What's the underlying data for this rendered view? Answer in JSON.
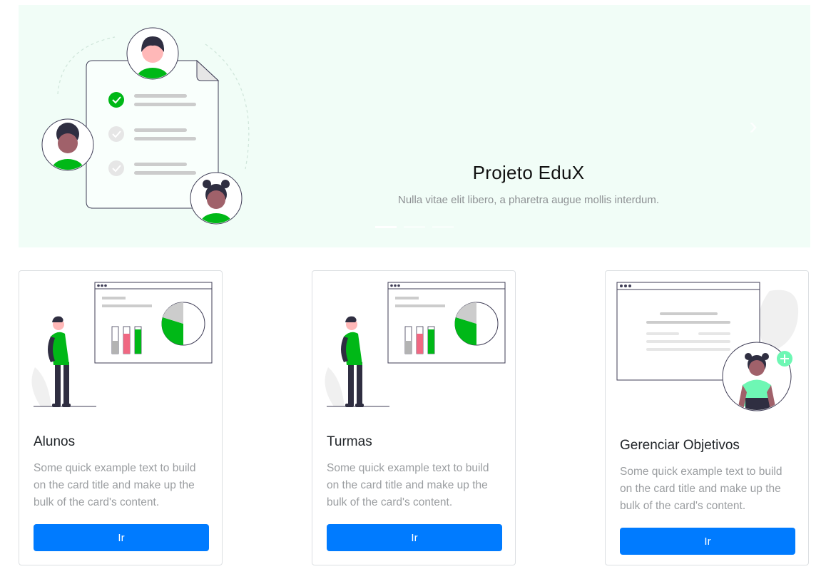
{
  "carousel": {
    "title": "Projeto EduX",
    "subtitle": "Nulla vitae elit libero, a pharetra augue mollis interdum.",
    "next_icon": "chevron-right-icon",
    "indicators": 3,
    "active_indicator": 0
  },
  "colors": {
    "accent_green": "#00b817",
    "hero_background": "#f1fdf7",
    "button_primary": "#007bff",
    "mint": "#6ef7b4",
    "pink": "#f06882"
  },
  "cards": [
    {
      "title": "Alunos",
      "text": "Some quick example text to build on the card title and make up the bulk of the card's content.",
      "button": "Ir"
    },
    {
      "title": "Turmas",
      "text": "Some quick example text to build on the card title and make up the bulk of the card's content.",
      "button": "Ir"
    },
    {
      "title": "Gerenciar Objetivos",
      "text": "Some quick example text to build on the card title and make up the bulk of the card's content.",
      "button": "Ir"
    }
  ]
}
